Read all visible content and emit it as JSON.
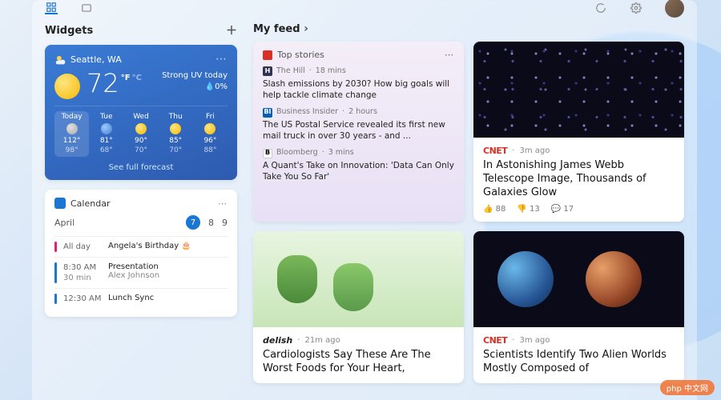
{
  "sections": {
    "widgets_label": "Widgets",
    "feed_label": "My feed"
  },
  "weather": {
    "location": "Seattle, WA",
    "temp": "72",
    "unit_f": "°F",
    "unit_c": "°C",
    "condition": "Strong UV today",
    "precip": "0%",
    "days": [
      {
        "label": "Today",
        "icon": "fc-cloud",
        "hi": "112°",
        "lo": "98°"
      },
      {
        "label": "Tue",
        "icon": "fc-rain",
        "hi": "81°",
        "lo": "68°"
      },
      {
        "label": "Wed",
        "icon": "fc-sun",
        "hi": "90°",
        "lo": "70°"
      },
      {
        "label": "Thu",
        "icon": "fc-sun",
        "hi": "85°",
        "lo": "70°"
      },
      {
        "label": "Fri",
        "icon": "fc-sun",
        "hi": "96°",
        "lo": "88°"
      }
    ],
    "full_forecast": "See full forecast"
  },
  "calendar": {
    "title": "Calendar",
    "month": "April",
    "dates": [
      "7",
      "8",
      "9"
    ],
    "selected_index": 0,
    "events": [
      {
        "color": "pink",
        "time": "All day",
        "duration": "",
        "title": "Angela's Birthday 🎂",
        "sub": ""
      },
      {
        "color": "blue",
        "time": "8:30 AM",
        "duration": "30 min",
        "title": "Presentation",
        "sub": "Alex Johnson"
      },
      {
        "color": "blue",
        "time": "12:30 AM",
        "duration": "",
        "title": "Lunch Sync",
        "sub": ""
      }
    ]
  },
  "top_stories": {
    "label": "Top stories",
    "items": [
      {
        "badge": "H",
        "source": "The Hill",
        "age": "18 mins",
        "title": "Slash emissions by 2030? How big goals will help tackle climate change"
      },
      {
        "badge": "BI",
        "source": "Business Insider",
        "age": "2 hours",
        "title": "The US Postal Service revealed its first new mail truck in over 30 years - and ..."
      },
      {
        "badge": "B",
        "source": "Bloomberg",
        "age": "3 mins",
        "title": "A Quant's Take on Innovation: 'Data Can Only Take You So Far'"
      }
    ]
  },
  "stories": {
    "webb": {
      "source_label": "CNET",
      "age": "3m ago",
      "title": "In Astonishing James Webb Telescope Image, Thousands of Galaxies Glow",
      "likes": "88",
      "dislikes": "13",
      "comments": "17"
    },
    "delish": {
      "source_label": "delish",
      "age": "21m ago",
      "title": "Cardiologists Say These Are The Worst Foods for Your Heart,"
    },
    "planets": {
      "source_label": "CNET",
      "age": "3m ago",
      "title": "Scientists Identify Two Alien Worlds Mostly Composed of"
    }
  },
  "watermark": "php 中文网"
}
